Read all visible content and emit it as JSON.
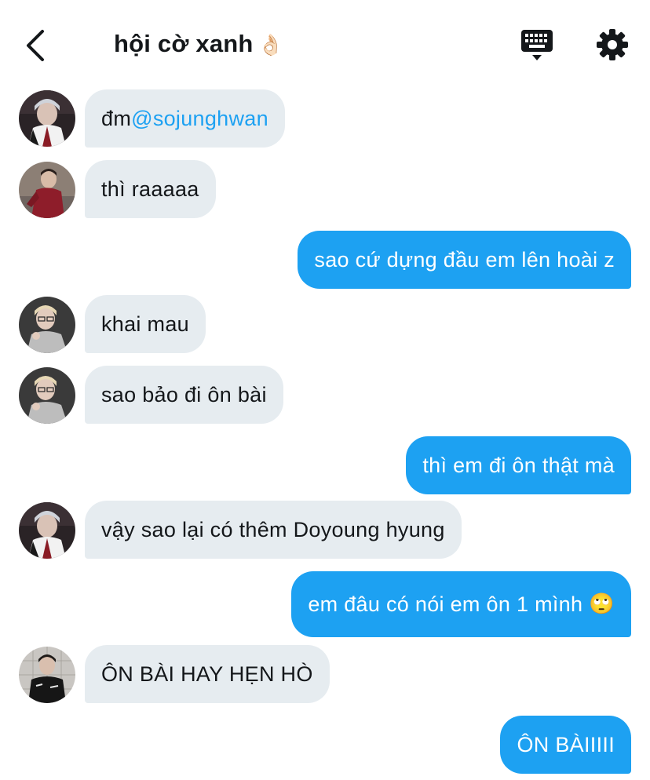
{
  "header": {
    "title": "hội cờ xanh",
    "title_emoji": "👌🏻",
    "back_icon": "chevron-left-icon",
    "keyboard_icon": "keyboard-icon",
    "settings_icon": "gear-icon"
  },
  "colors": {
    "accent": "#1da1f2",
    "incoming_bubble": "#e6ecf0",
    "text": "#14171a"
  },
  "messages": [
    {
      "direction": "incoming",
      "avatar": "user-a",
      "text": "đm ",
      "mention": "@sojunghwan"
    },
    {
      "direction": "incoming",
      "avatar": "user-b",
      "text": "thì raaaaa"
    },
    {
      "direction": "outgoing",
      "text": "sao cứ dựng đầu em lên hoài z"
    },
    {
      "direction": "incoming",
      "avatar": "user-c",
      "text": "khai mau"
    },
    {
      "direction": "incoming",
      "avatar": "user-c",
      "text": "sao bảo đi ôn bài"
    },
    {
      "direction": "outgoing",
      "text": "thì em đi ôn thật mà"
    },
    {
      "direction": "incoming",
      "avatar": "user-a",
      "text": "vậy sao lại có thêm Doyoung hyung"
    },
    {
      "direction": "outgoing",
      "text": "em đâu có nói em ôn 1 mình",
      "emoji": "🙄"
    },
    {
      "direction": "incoming",
      "avatar": "user-d",
      "text": "ÔN BÀI HAY HẸN HÒ"
    },
    {
      "direction": "outgoing",
      "text": "ÔN BÀIIIII"
    }
  ]
}
